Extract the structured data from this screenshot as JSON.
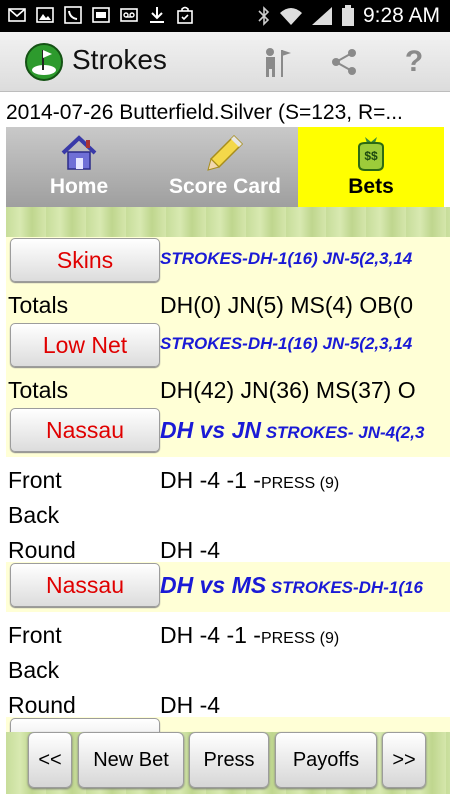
{
  "status_bar": {
    "time": "9:28 AM",
    "left_icons": [
      "mail-icon",
      "gallery-icon",
      "phone-icon",
      "zone-icon",
      "voicemail-icon",
      "download-icon",
      "shopping-bag-icon"
    ],
    "right_icons": [
      "bluetooth-icon",
      "wifi-icon",
      "signal-icon",
      "battery-icon"
    ]
  },
  "app_bar": {
    "title": "Strokes",
    "actions": [
      "golfer-flag-icon",
      "share-icon",
      "help-icon"
    ],
    "help_glyph": "?"
  },
  "round_info": "2014-07-26 Butterfield.Silver (S=123, R=...",
  "tabs": [
    {
      "label": "Home",
      "icon": "house-icon",
      "active": false
    },
    {
      "label": "Score Card",
      "icon": "pencil-icon",
      "active": false
    },
    {
      "label": "Bets",
      "icon": "money-bag-icon",
      "active": true
    }
  ],
  "bets": [
    {
      "button": "Skins",
      "desc_big": "",
      "desc_small": "STROKES-DH-1(16) JN-5(2,3,14",
      "totals_label": "Totals",
      "totals_value": "DH(0) JN(5) MS(4) OB(0"
    },
    {
      "button": "Low Net",
      "desc_big": "",
      "desc_small": "STROKES-DH-1(16) JN-5(2,3,14",
      "totals_label": "Totals",
      "totals_value": "DH(42) JN(36) MS(37) O"
    },
    {
      "button": "Nassau",
      "desc_big": "DH vs JN",
      "desc_small": " STROKES- JN-4(2,3",
      "front_label": "Front",
      "front_value": "DH -4 -1  -",
      "front_press": "PRESS (9)",
      "back_label": "Back",
      "round_label": "Round",
      "round_value": "DH -4"
    },
    {
      "button": "Nassau",
      "desc_big": "DH vs MS",
      "desc_small": " STROKES-DH-1(16",
      "front_label": "Front",
      "front_value": "DH -4 -1  -",
      "front_press": "PRESS (9)",
      "back_label": "Back",
      "round_label": "Round",
      "round_value": "DH -4"
    }
  ],
  "bottom_bar": {
    "prev": "<<",
    "new_bet": "New Bet",
    "press": "Press",
    "payoffs": "Payoffs",
    "next": ">>"
  },
  "colors": {
    "active_tab": "#ffff00",
    "bet_label": "#e00000",
    "desc_blue": "#1a1ad6",
    "highlight_row": "#ffffd6"
  }
}
